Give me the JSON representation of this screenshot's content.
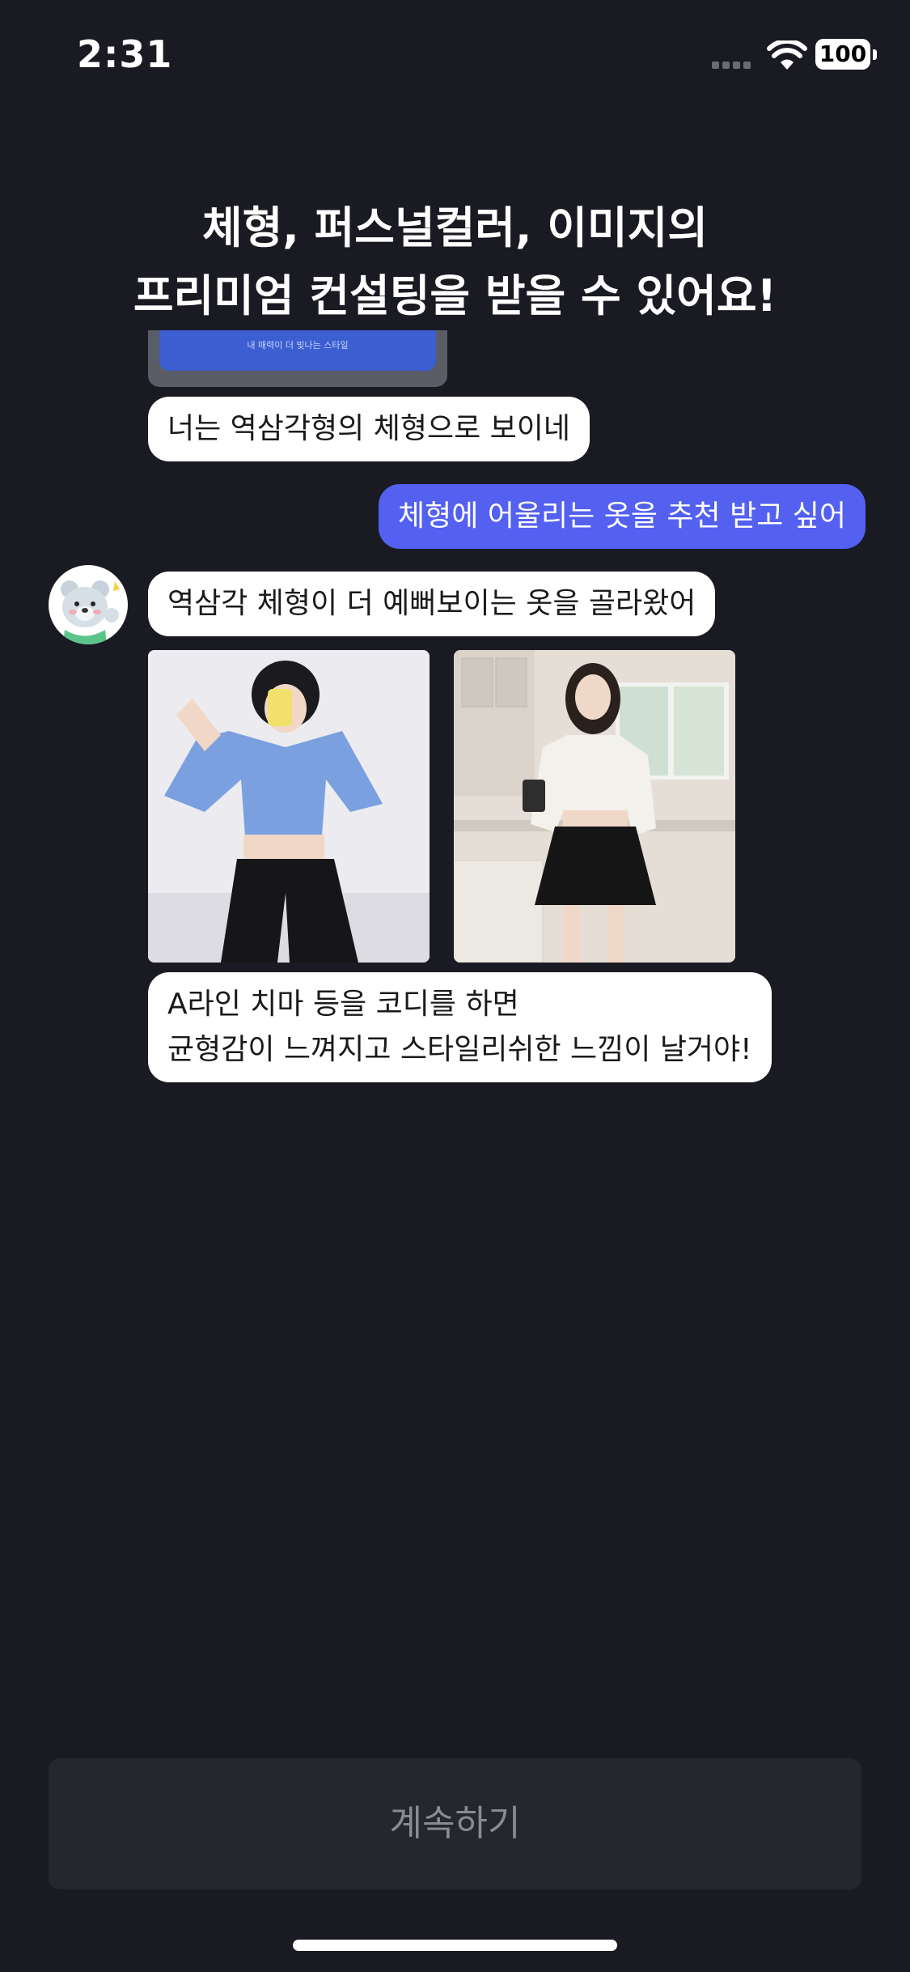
{
  "status_bar": {
    "time": "2:31",
    "battery": "100"
  },
  "headline": {
    "line1": "체형, 퍼스널컬러, 이미지의",
    "line2": "프리미엄 컨설팅을 받을 수 있어요!"
  },
  "chat": {
    "prev_card_caption": "내 매력이 더 빛나는 스타일",
    "messages": [
      {
        "from": "bot",
        "text": "너는 역삼각형의 체형으로 보이네"
      },
      {
        "from": "user",
        "text": "체형에 어울리는 옷을 추천 받고 싶어"
      },
      {
        "from": "bot",
        "text": "역삼각 체형이 더 예뻐보이는 옷을 골라왔어"
      },
      {
        "from": "bot",
        "lines": [
          "A라인 치마 등을 코디를 하면",
          "균형감이 느껴지고 스타일리쉬한 느낌이 날거야!"
        ]
      }
    ],
    "photos": [
      "outfit-photo-blue-crop-top",
      "outfit-photo-white-top-black-skirt"
    ]
  },
  "cta": {
    "label": "계속하기"
  },
  "colors": {
    "background": "#191a22",
    "user_bubble": "#5360f0",
    "bot_bubble": "#ffffff",
    "cta_bg": "#25262e"
  }
}
